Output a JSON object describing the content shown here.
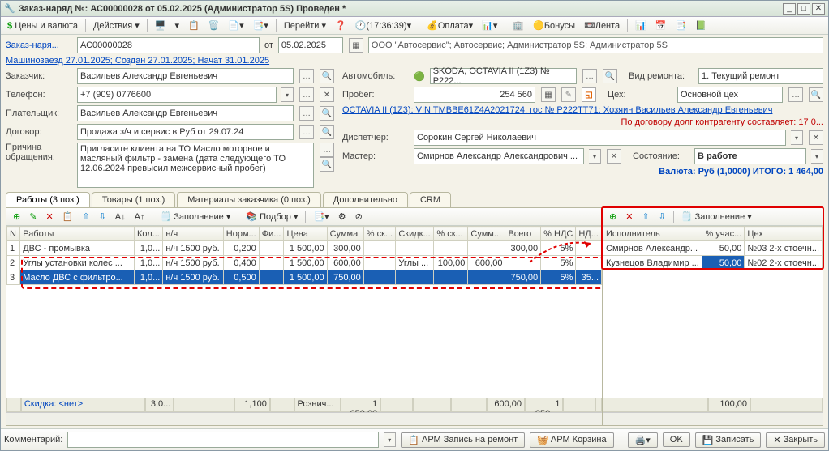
{
  "window": {
    "title": "Заказ-наряд №: АС00000028 от 05.02.2025 (Администратор 5S) Проведен *"
  },
  "tb": {
    "prices": "Цены и валюта",
    "actions": "Действия",
    "go": "Перейти",
    "time": "(17:36:39)",
    "pay": "Оплата",
    "bonus": "Бонусы",
    "tape": "Лента"
  },
  "hdr": {
    "orderLbl": "Заказ-наря...",
    "orderNo": "АС00000028",
    "otLbl": "от",
    "date": "05.02.2025",
    "org": "ООО \"Автосервис\"; Автосервис; Администратор 5S; Администратор 5S",
    "topLink": "Машинозаезд 27.01.2025; Создан 27.01.2025; Начат 31.01.2025",
    "customerLbl": "Заказчик:",
    "customer": "Васильев Александр Евгеньевич",
    "phoneLbl": "Телефон:",
    "phone": "+7 (909) 0776600",
    "payerLbl": "Плательщик:",
    "payer": "Васильев Александр Евгеньевич",
    "contractLbl": "Договор:",
    "contract": "Продажа з/ч и сервис в Руб от 29.07.24",
    "reasonLbl": "Причина обращения:",
    "reason": "Пригласите клиента на ТО\nМасло моторное и масляный фильтр - замена (дата следующего ТО 12.06.2024 превысил межсервисный пробег)",
    "carLbl": "Автомобиль:",
    "car": "SKODA, OCTAVIA II (1Z3) № Р222...",
    "mileageLbl": "Пробег:",
    "mileage": "254 560",
    "repairLbl": "Вид ремонта:",
    "repair": "1. Текущий ремонт",
    "shopLbl": "Цех:",
    "shop": "Основной цех",
    "vinLink": "OCTAVIA II (1Z3); VIN TMBBE61Z4A2021724; гос № Р222ТТ71; Хозяин Васильев Александр Евгеньевич",
    "debtLink": "По договору долг контрагенту составляет: 17 0...",
    "dispatcherLbl": "Диспетчер:",
    "dispatcher": "Сорокин Сергей Николаевич",
    "masterLbl": "Мастер:",
    "master": "Смирнов Александр Александрович ...",
    "stateLbl": "Состояние:",
    "state": "В работе",
    "totalLine": "Валюта: Руб (1,0000) ИТОГО: 1 464,00"
  },
  "tabs": [
    "Работы (3 поз.)",
    "Товары (1 поз.)",
    "Материалы заказчика (0 поз.)",
    "Дополнительно",
    "CRM"
  ],
  "gridtb": {
    "fill": "Заполнение",
    "pick": "Подбор"
  },
  "works": {
    "cols": [
      "N",
      "Работы",
      "Кол...",
      "н/ч",
      "Норм...",
      "Фи...",
      "Цена",
      "Сумма",
      "% ск...",
      "Скидк...",
      "% ск...",
      "Сумм...",
      "Всего",
      "% НДС",
      "НД..."
    ],
    "rows": [
      {
        "n": "1",
        "name": "ДВС - промывка",
        "qty": "1,0...",
        "nh": "н/ч 1500 руб.",
        "norm": "0,200",
        "fi": "",
        "price": "1 500,00",
        "sum": "300,00",
        "d1": "",
        "d2": "",
        "d3": "",
        "d4": "",
        "total": "300,00",
        "vat": "5%",
        "vs": ""
      },
      {
        "n": "2",
        "name": "Углы установки колес ...",
        "qty": "1,0...",
        "nh": "н/ч 1500 руб.",
        "norm": "0,400",
        "fi": "",
        "price": "1 500,00",
        "sum": "600,00",
        "d1": "",
        "d2": "Углы ...",
        "d3": "100,00",
        "d4": "600,00",
        "total": "",
        "vat": "5%",
        "vs": ""
      },
      {
        "n": "3",
        "name": "Масло ДВС с фильтро...",
        "qty": "1,0...",
        "nh": "н/ч 1500 руб.",
        "norm": "0,500",
        "fi": "",
        "price": "1 500,00",
        "sum": "750,00",
        "d1": "",
        "d2": "",
        "d3": "",
        "d4": "",
        "total": "750,00",
        "vat": "5%",
        "vs": "35..."
      }
    ],
    "footer": {
      "skidka": "Скидка: <нет>",
      "c1": "3,0...",
      "c2": "1,100",
      "c3": "Рознич...",
      "c4": "1 650,00",
      "c5": "600,00",
      "c6": "1 050,..."
    }
  },
  "exec": {
    "fillLbl": "Заполнение",
    "cols": [
      "Исполнитель",
      "% учас...",
      "Цех"
    ],
    "rows": [
      {
        "name": "Смирнов Александр...",
        "pct": "50,00",
        "shop": "№03  2-х стоечн..."
      },
      {
        "name": "Кузнецов Владимир ...",
        "pct": "50,00",
        "shop": "№02  2-х стоечн..."
      }
    ],
    "footer": "100,00"
  },
  "bottom": {
    "commentLbl": "Комментарий:",
    "arm": "АРМ Запись на ремонт",
    "basket": "АРМ Корзина",
    "ok": "OK",
    "save": "Записать",
    "close": "Закрыть"
  }
}
